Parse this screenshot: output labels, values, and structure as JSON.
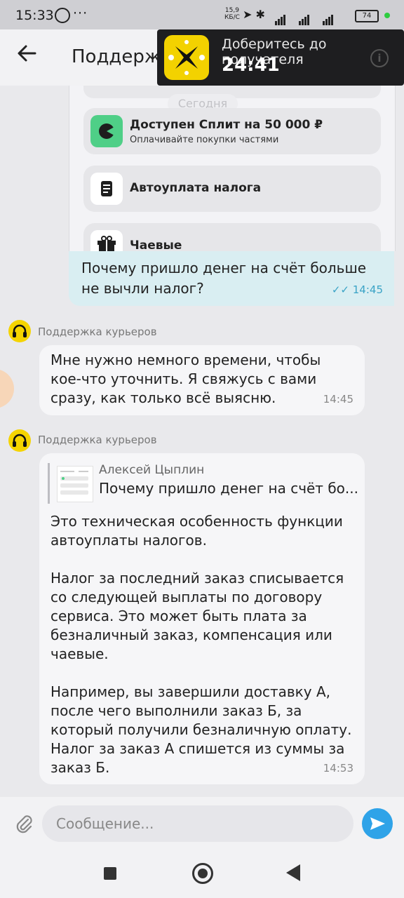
{
  "status_bar": {
    "time": "15:33",
    "speed_value": "15,9",
    "speed_unit": "КБ/С",
    "battery": "74",
    "icons": [
      "whatsapp-icon",
      "navigation-icon",
      "bluetooth-icon",
      "volte-icon",
      "4g-signal-icon",
      "wifi-icon",
      "battery-icon"
    ]
  },
  "header": {
    "title": "Поддержк",
    "back_icon": "arrow-left-icon"
  },
  "banner": {
    "text": "Доберитесь до получателя",
    "timer": "24:41",
    "info_icon": "info-icon"
  },
  "attachment_preview": {
    "date_label": "Сегодня",
    "features": [
      {
        "title": "Доступен Сплит на 50 000 ₽",
        "subtitle": "Оплачивайте покупки частями",
        "icon": "split-icon"
      },
      {
        "title": "Автоуплата налога",
        "subtitle": "",
        "icon": "document-icon"
      },
      {
        "title": "Чаевые",
        "subtitle": "",
        "icon": "gift-icon"
      }
    ]
  },
  "messages": {
    "outgoing": {
      "text": "Почему пришло денег на счёт больше не вычли налог?",
      "time": "14:45",
      "status_icon": "double-check-icon"
    },
    "incoming_1": {
      "sender": "Поддержка курьеров",
      "text": "Мне нужно немного времени, чтобы кое-что уточнить. Я свяжусь с вами сразу, как только всё выясню.",
      "time": "14:45"
    },
    "incoming_2": {
      "sender": "Поддержка курьеров",
      "quote_author": "Алексей Цыплин",
      "quote_text": "Почему пришло денег на счёт бо...",
      "text": "Это техническая особенность функции автоуплаты налогов.\n\nНалог за последний заказ списывается со следующей выплаты по договору сервиса. Это может быть плата за безналичный заказ, компенсация или чаевые.\n\nНапример, вы завершили доставку А, после чего выполнили заказ Б, за который получили безналичную оплату. Налог за заказ А спишется из суммы за заказ Б.",
      "time": "14:53"
    }
  },
  "input": {
    "placeholder": "Сообщение...",
    "attach_icon": "paperclip-icon",
    "send_icon": "send-icon"
  },
  "colors": {
    "outgoing_bubble": "#d9eef2",
    "incoming_bubble": "#f6f6f8",
    "accent_blue": "#2fa3e8",
    "avatar_yellow": "#f5d400",
    "split_green": "#4fcf87"
  }
}
